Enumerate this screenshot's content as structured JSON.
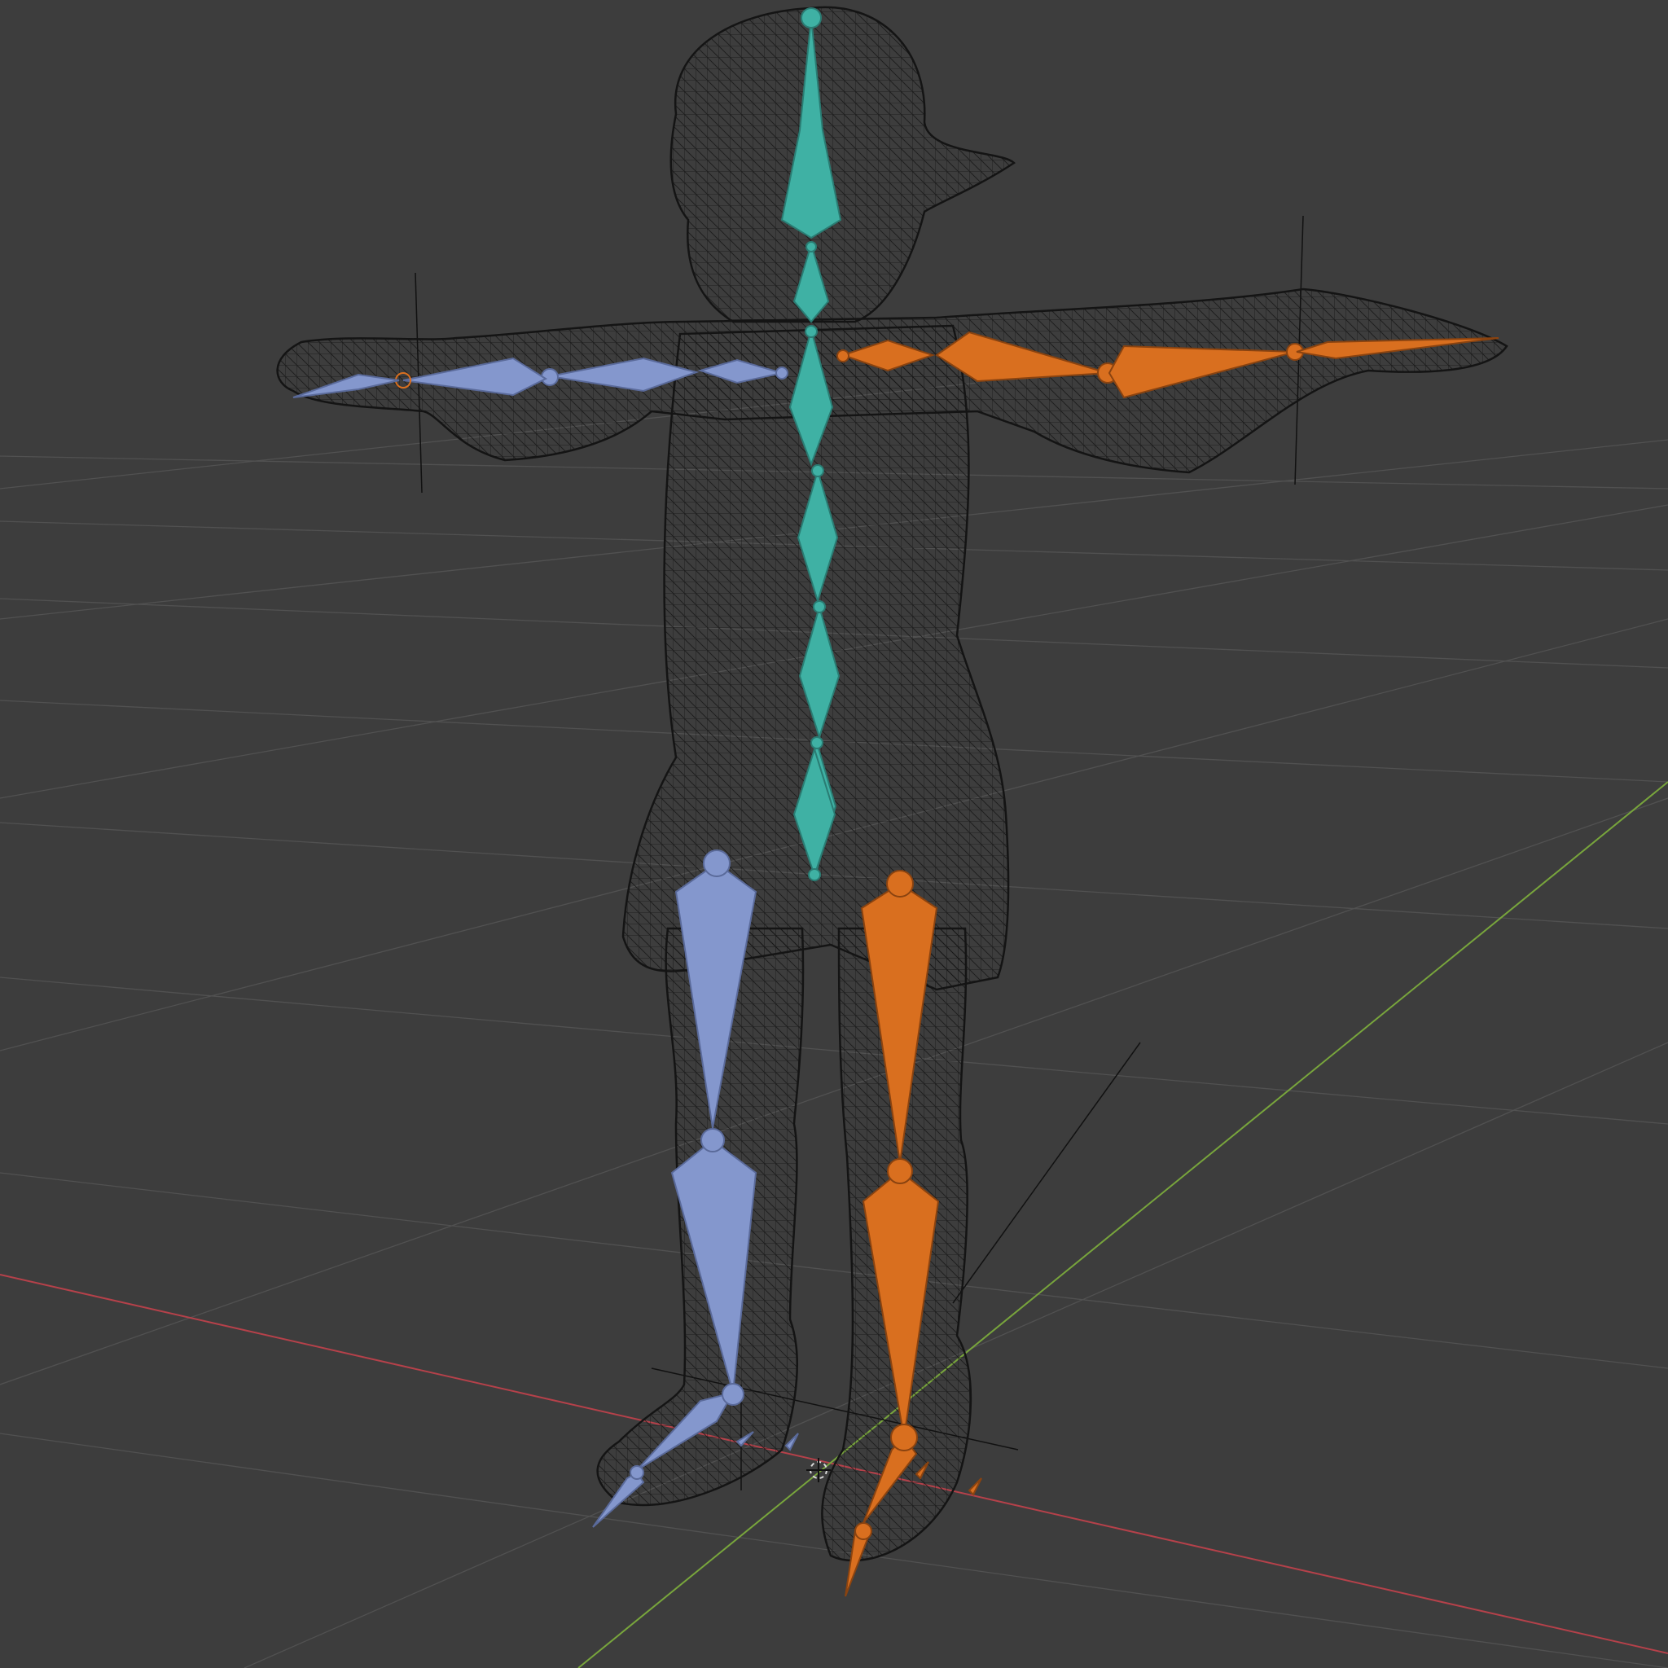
{
  "viewport": {
    "mode": "wireframe",
    "background_color": "#3d3d3d",
    "grid_line_color": "#555555",
    "x_axis_color": "#b5414a",
    "y_axis_color": "#78a53c",
    "wireframe_color": "#141414"
  },
  "armature": {
    "spine_color": "#3fb1a4",
    "left_side_color": "#8497cd",
    "right_side_color": "#d96f1f",
    "spine_bones": [
      "head",
      "neck",
      "chest",
      "spine-upper",
      "spine-mid",
      "spine-lower",
      "pelvis"
    ],
    "left_bones": [
      "upper-arm-left",
      "forearm-left",
      "hand-left",
      "thigh-left",
      "shin-left",
      "foot-left",
      "toe-left"
    ],
    "right_bones": [
      "upper-arm-right",
      "forearm-right",
      "hand-right",
      "thigh-right",
      "shin-right",
      "foot-right",
      "toe-right"
    ]
  }
}
